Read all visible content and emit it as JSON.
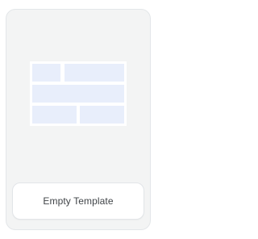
{
  "template_card": {
    "label": "Empty Template",
    "preview_icon": "layout-grid-icon",
    "colors": {
      "card_background": "#f3f4f4",
      "block_fill": "#e8eefb",
      "block_border": "#ffffff"
    }
  }
}
